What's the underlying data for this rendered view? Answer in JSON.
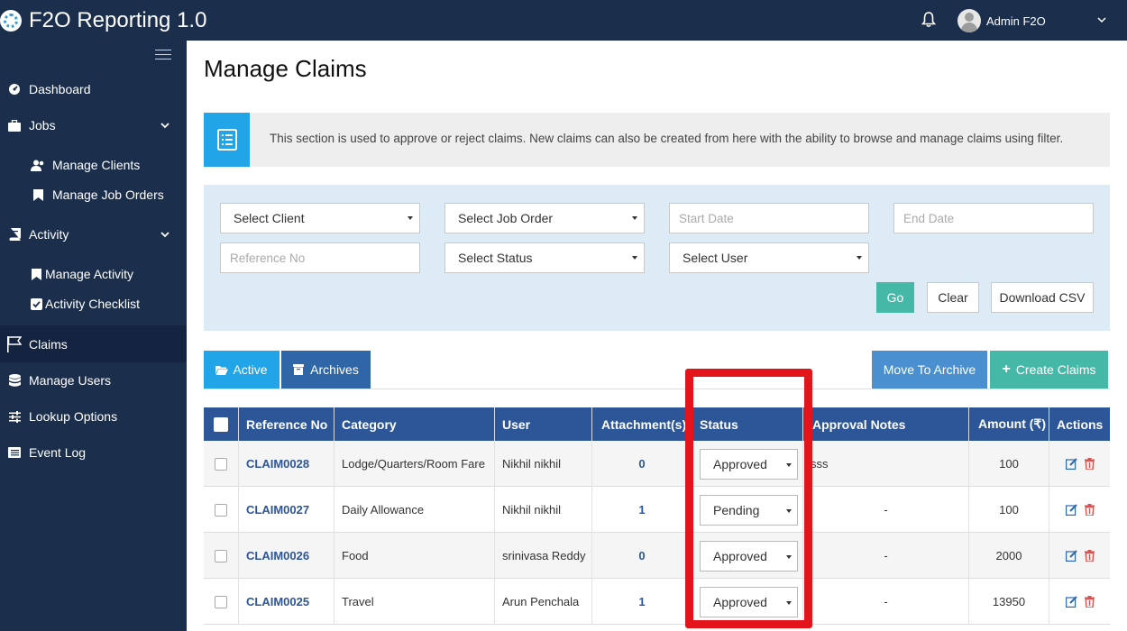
{
  "app": {
    "title": "F2O Reporting 1.0",
    "user": "Admin F2O"
  },
  "sidebar": {
    "items": [
      {
        "label": "Dashboard",
        "icon": "dashboard-icon"
      },
      {
        "label": "Jobs",
        "icon": "briefcase-icon"
      },
      {
        "label": "Manage Clients",
        "icon": "users-icon"
      },
      {
        "label": "Manage Job Orders",
        "icon": "bookmark-icon"
      },
      {
        "label": "Activity",
        "icon": "book-icon"
      },
      {
        "label": "Manage Activity",
        "icon": "bookmark-icon"
      },
      {
        "label": "Activity Checklist",
        "icon": "check-square-icon"
      },
      {
        "label": "Claims",
        "icon": "flag-icon"
      },
      {
        "label": "Manage Users",
        "icon": "database-icon"
      },
      {
        "label": "Lookup Options",
        "icon": "sliders-icon"
      },
      {
        "label": "Event Log",
        "icon": "list-icon"
      }
    ]
  },
  "page": {
    "title": "Manage Claims",
    "info": "This section is used to approve or reject claims. New claims can also be created from here with the ability to browse and manage claims using filter."
  },
  "filters": {
    "client": "Select Client",
    "job_order": "Select Job Order",
    "start_date_placeholder": "Start Date",
    "end_date_placeholder": "End Date",
    "reference_placeholder": "Reference No",
    "status": "Select Status",
    "user": "Select User",
    "go": "Go",
    "clear": "Clear",
    "download": "Download CSV"
  },
  "tabs": {
    "active": "Active",
    "archives": "Archives"
  },
  "actions": {
    "move_archive": "Move To Archive",
    "create": "Create Claims"
  },
  "table": {
    "headers": {
      "ref": "Reference No",
      "category": "Category",
      "user": "User",
      "attachments": "Attachment(s)",
      "status": "Status",
      "notes": "Approval Notes",
      "amount": "Amount (₹)",
      "actions": "Actions"
    },
    "rows": [
      {
        "ref": "CLAIM0028",
        "category": "Lodge/Quarters/Room Fare",
        "user": "Nikhil nikhil",
        "attachments": "0",
        "status": "Approved",
        "notes": "sss",
        "amount": "100"
      },
      {
        "ref": "CLAIM0027",
        "category": "Daily Allowance",
        "user": "Nikhil nikhil",
        "attachments": "1",
        "status": "Pending",
        "notes": "-",
        "amount": "100"
      },
      {
        "ref": "CLAIM0026",
        "category": "Food",
        "user": "srinivasa Reddy",
        "attachments": "0",
        "status": "Approved",
        "notes": "-",
        "amount": "2000"
      },
      {
        "ref": "CLAIM0025",
        "category": "Travel",
        "user": "Arun Penchala",
        "attachments": "1",
        "status": "Approved",
        "notes": "-",
        "amount": "13950"
      }
    ]
  },
  "colors": {
    "sidebar": "#1b2e4b",
    "table_header": "#2d5699",
    "accent_blue": "#22a4e8",
    "accent_green": "#46b8a8",
    "highlight": "#e3141b"
  }
}
